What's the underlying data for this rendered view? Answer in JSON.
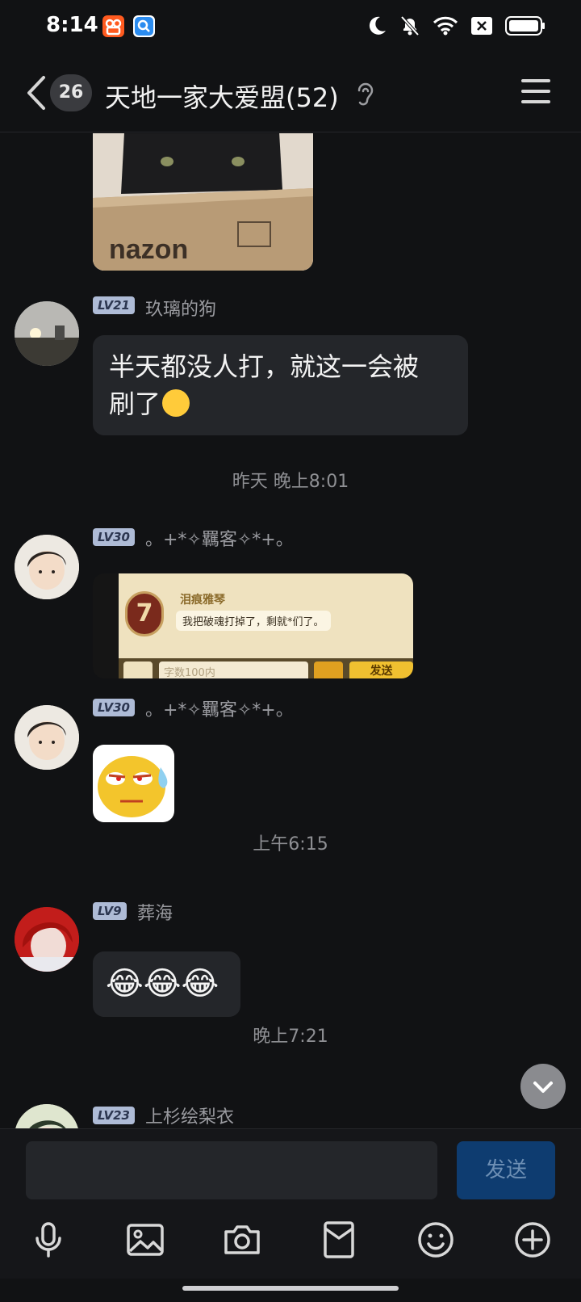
{
  "status_bar": {
    "time": "8:14"
  },
  "header": {
    "unread_count": "26",
    "title": "天地一家大爱盟(52)"
  },
  "messages": [
    {
      "level": "LV21",
      "nickname": "玖璃的狗",
      "text_line1": "半天都没人打，就这一会被",
      "text_line2": "刷了"
    },
    {
      "timestamp": "昨天 晚上8:01"
    },
    {
      "level": "LV30",
      "nickname": "。+*✧羈客✧*+。",
      "image": {
        "name": "泪痕雅琴",
        "text": "我把破魂打掉了，剩就*们了。",
        "placeholder": "字数100内",
        "send": "发送"
      }
    },
    {
      "level": "LV30",
      "nickname": "。+*✧羈客✧*+。"
    },
    {
      "timestamp": "上午6:15"
    },
    {
      "level": "LV9",
      "nickname": "葬海",
      "emojis": "😂😂😂"
    },
    {
      "timestamp": "晚上7:21"
    },
    {
      "level": "LV23",
      "nickname": "上杉绘梨衣"
    }
  ],
  "input": {
    "value": "",
    "placeholder": "",
    "send_label": "发送"
  },
  "colors": {
    "background": "#111214",
    "bubble": "#24262a",
    "send_button": "#0e3c70",
    "level_badge": "#aebbd6"
  }
}
